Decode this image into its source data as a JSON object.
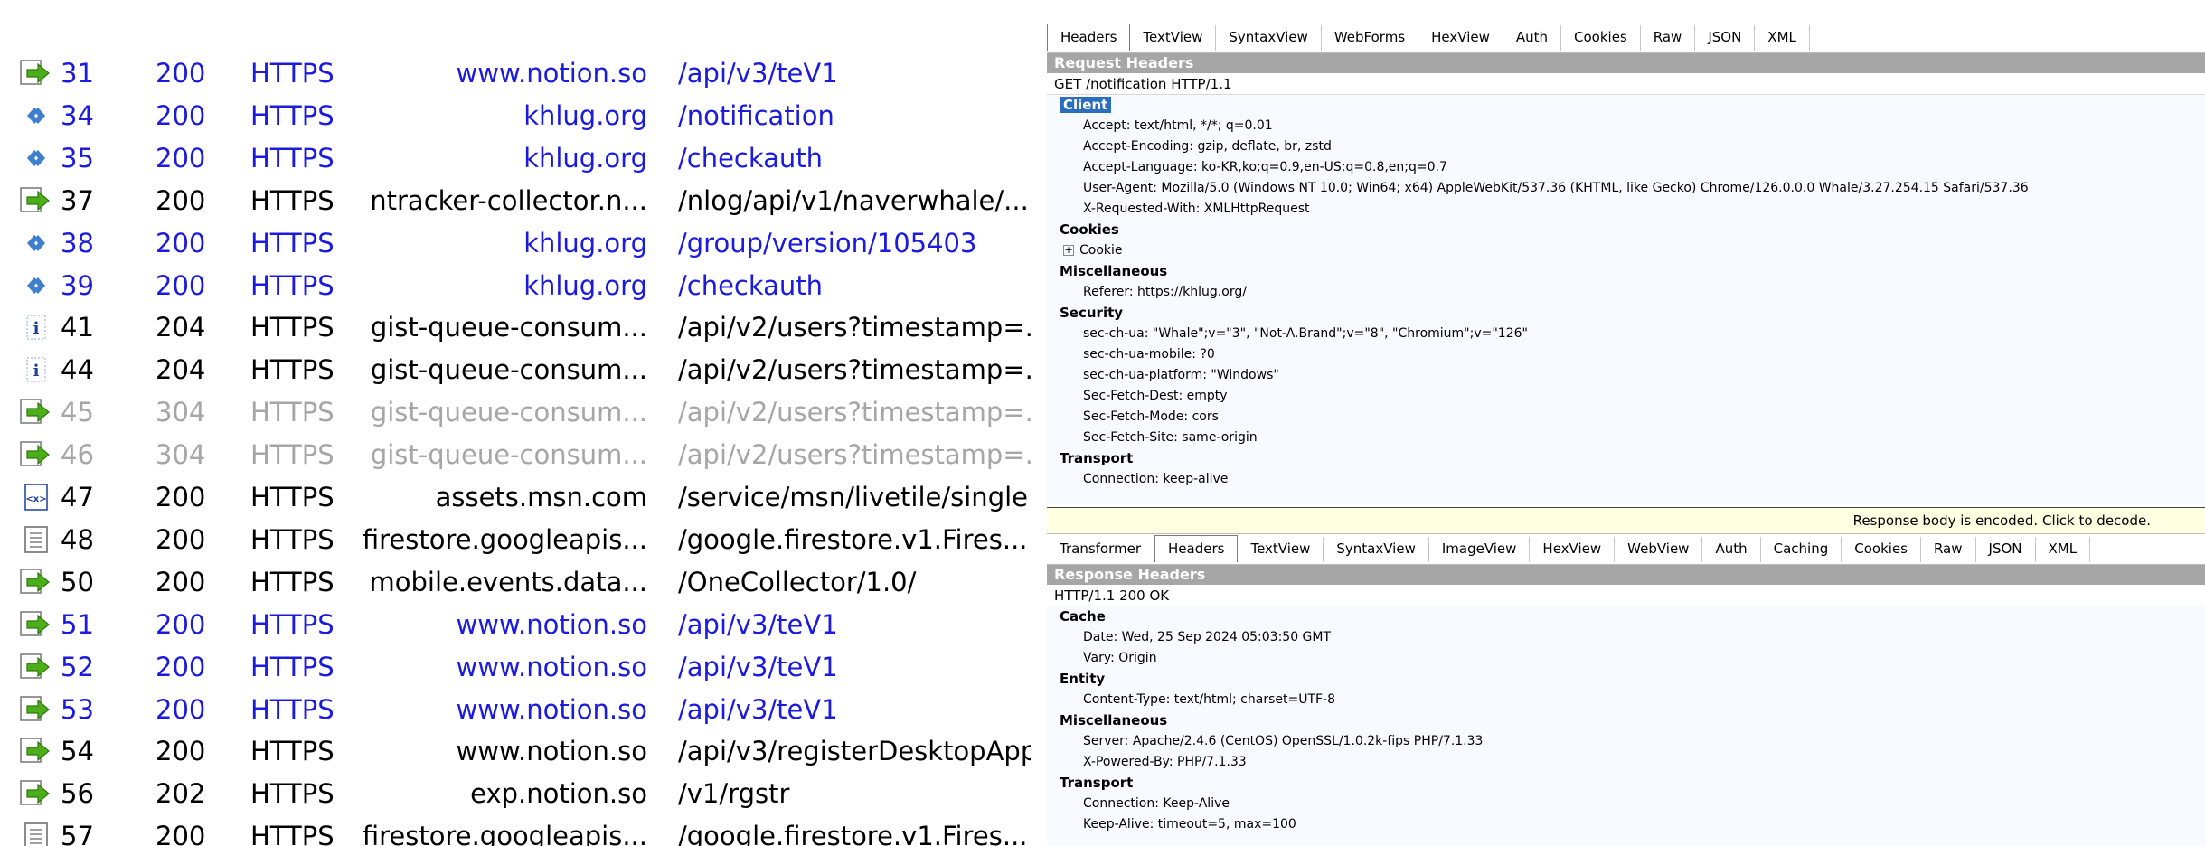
{
  "sessions": [
    {
      "num": "31",
      "result": "200",
      "protocol": "HTTPS",
      "host": "www.notion.so",
      "url": "/api/v3/teV1",
      "icon": "arrow-right-icon",
      "style": "blue"
    },
    {
      "num": "34",
      "result": "200",
      "protocol": "HTTPS",
      "host": "khlug.org",
      "url": "/notification",
      "icon": "diamonds-icon",
      "style": "blue"
    },
    {
      "num": "35",
      "result": "200",
      "protocol": "HTTPS",
      "host": "khlug.org",
      "url": "/checkauth",
      "icon": "diamonds-icon",
      "style": "blue"
    },
    {
      "num": "37",
      "result": "200",
      "protocol": "HTTPS",
      "host": "ntracker-collector.n...",
      "url": "/nlog/api/v1/naverwhale/...",
      "icon": "arrow-right-icon",
      "style": "black"
    },
    {
      "num": "38",
      "result": "200",
      "protocol": "HTTPS",
      "host": "khlug.org",
      "url": "/group/version/105403",
      "icon": "diamonds-icon",
      "style": "blue"
    },
    {
      "num": "39",
      "result": "200",
      "protocol": "HTTPS",
      "host": "khlug.org",
      "url": "/checkauth",
      "icon": "diamonds-icon",
      "style": "blue"
    },
    {
      "num": "41",
      "result": "204",
      "protocol": "HTTPS",
      "host": "gist-queue-consum...",
      "url": "/api/v2/users?timestamp=...",
      "icon": "info-icon",
      "style": "black"
    },
    {
      "num": "44",
      "result": "204",
      "protocol": "HTTPS",
      "host": "gist-queue-consum...",
      "url": "/api/v2/users?timestamp=...",
      "icon": "info-icon",
      "style": "black"
    },
    {
      "num": "45",
      "result": "304",
      "protocol": "HTTPS",
      "host": "gist-queue-consum...",
      "url": "/api/v2/users?timestamp=...",
      "icon": "arrow-right-icon",
      "style": "gray"
    },
    {
      "num": "46",
      "result": "304",
      "protocol": "HTTPS",
      "host": "gist-queue-consum...",
      "url": "/api/v2/users?timestamp=...",
      "icon": "arrow-right-icon",
      "style": "gray"
    },
    {
      "num": "47",
      "result": "200",
      "protocol": "HTTPS",
      "host": "assets.msn.com",
      "url": "/service/msn/livetile/single...",
      "icon": "html-doc-icon",
      "style": "black"
    },
    {
      "num": "48",
      "result": "200",
      "protocol": "HTTPS",
      "host": "firestore.googleapis...",
      "url": "/google.firestore.v1.Fires...",
      "icon": "text-doc-icon",
      "style": "black"
    },
    {
      "num": "50",
      "result": "200",
      "protocol": "HTTPS",
      "host": "mobile.events.data...",
      "url": "/OneCollector/1.0/",
      "icon": "arrow-right-icon",
      "style": "black"
    },
    {
      "num": "51",
      "result": "200",
      "protocol": "HTTPS",
      "host": "www.notion.so",
      "url": "/api/v3/teV1",
      "icon": "arrow-right-icon",
      "style": "blue"
    },
    {
      "num": "52",
      "result": "200",
      "protocol": "HTTPS",
      "host": "www.notion.so",
      "url": "/api/v3/teV1",
      "icon": "arrow-right-icon",
      "style": "blue"
    },
    {
      "num": "53",
      "result": "200",
      "protocol": "HTTPS",
      "host": "www.notion.so",
      "url": "/api/v3/teV1",
      "icon": "arrow-right-icon",
      "style": "blue"
    },
    {
      "num": "54",
      "result": "200",
      "protocol": "HTTPS",
      "host": "www.notion.so",
      "url": "/api/v3/registerDesktopApp",
      "icon": "arrow-right-icon",
      "style": "black"
    },
    {
      "num": "56",
      "result": "202",
      "protocol": "HTTPS",
      "host": "exp.notion.so",
      "url": "/v1/rgstr",
      "icon": "arrow-right-icon",
      "style": "black"
    },
    {
      "num": "57",
      "result": "200",
      "protocol": "HTTPS",
      "host": "firestore.googleapis...",
      "url": "/google.firestore.v1.Fires...",
      "icon": "text-doc-icon",
      "style": "black"
    }
  ],
  "request": {
    "tabs": [
      "Headers",
      "TextView",
      "SyntaxView",
      "WebForms",
      "HexView",
      "Auth",
      "Cookies",
      "Raw",
      "JSON",
      "XML"
    ],
    "active_tab": "Headers",
    "section_title": "Request Headers",
    "status_line": "GET /notification HTTP/1.1",
    "groups": [
      {
        "name": "Client",
        "selected": true,
        "items": [
          "Accept: text/html, */*; q=0.01",
          "Accept-Encoding: gzip, deflate, br, zstd",
          "Accept-Language: ko-KR,ko;q=0.9,en-US;q=0.8,en;q=0.7",
          "User-Agent: Mozilla/5.0 (Windows NT 10.0; Win64; x64) AppleWebKit/537.36 (KHTML, like Gecko) Chrome/126.0.0.0 Whale/3.27.254.15 Safari/537.36",
          "X-Requested-With: XMLHttpRequest"
        ]
      },
      {
        "name": "Cookies",
        "selected": false,
        "expander": "Cookie",
        "items": []
      },
      {
        "name": "Miscellaneous",
        "selected": false,
        "items": [
          "Referer: https://khlug.org/"
        ]
      },
      {
        "name": "Security",
        "selected": false,
        "items": [
          "sec-ch-ua: \"Whale\";v=\"3\", \"Not-A.Brand\";v=\"8\", \"Chromium\";v=\"126\"",
          "sec-ch-ua-mobile: ?0",
          "sec-ch-ua-platform: \"Windows\"",
          "Sec-Fetch-Dest: empty",
          "Sec-Fetch-Mode: cors",
          "Sec-Fetch-Site: same-origin"
        ]
      },
      {
        "name": "Transport",
        "selected": false,
        "items": [
          "Connection: keep-alive"
        ]
      }
    ]
  },
  "banner": "Response body is encoded. Click to decode.",
  "response": {
    "tabs": [
      "Transformer",
      "Headers",
      "TextView",
      "SyntaxView",
      "ImageView",
      "HexView",
      "WebView",
      "Auth",
      "Caching",
      "Cookies",
      "Raw",
      "JSON",
      "XML"
    ],
    "active_tab": "Headers",
    "section_title": "Response Headers",
    "status_line": "HTTP/1.1 200 OK",
    "groups": [
      {
        "name": "Cache",
        "items": [
          "Date: Wed, 25 Sep 2024 05:03:50 GMT",
          "Vary: Origin"
        ]
      },
      {
        "name": "Entity",
        "items": [
          "Content-Type: text/html; charset=UTF-8"
        ]
      },
      {
        "name": "Miscellaneous",
        "items": [
          "Server: Apache/2.4.6 (CentOS) OpenSSL/1.0.2k-fips PHP/7.1.33",
          "X-Powered-By: PHP/7.1.33"
        ]
      },
      {
        "name": "Transport",
        "items": [
          "Connection: Keep-Alive",
          "Keep-Alive: timeout=5, max=100"
        ]
      }
    ]
  },
  "colors": {
    "blue_text": "#1b1be0",
    "gray_text": "#a6a6a6",
    "section_bar": "#a6a6a6",
    "selection": "#2a6fbe",
    "banner_bg": "#ffffe1",
    "pane_bg": "#f7fbff"
  }
}
